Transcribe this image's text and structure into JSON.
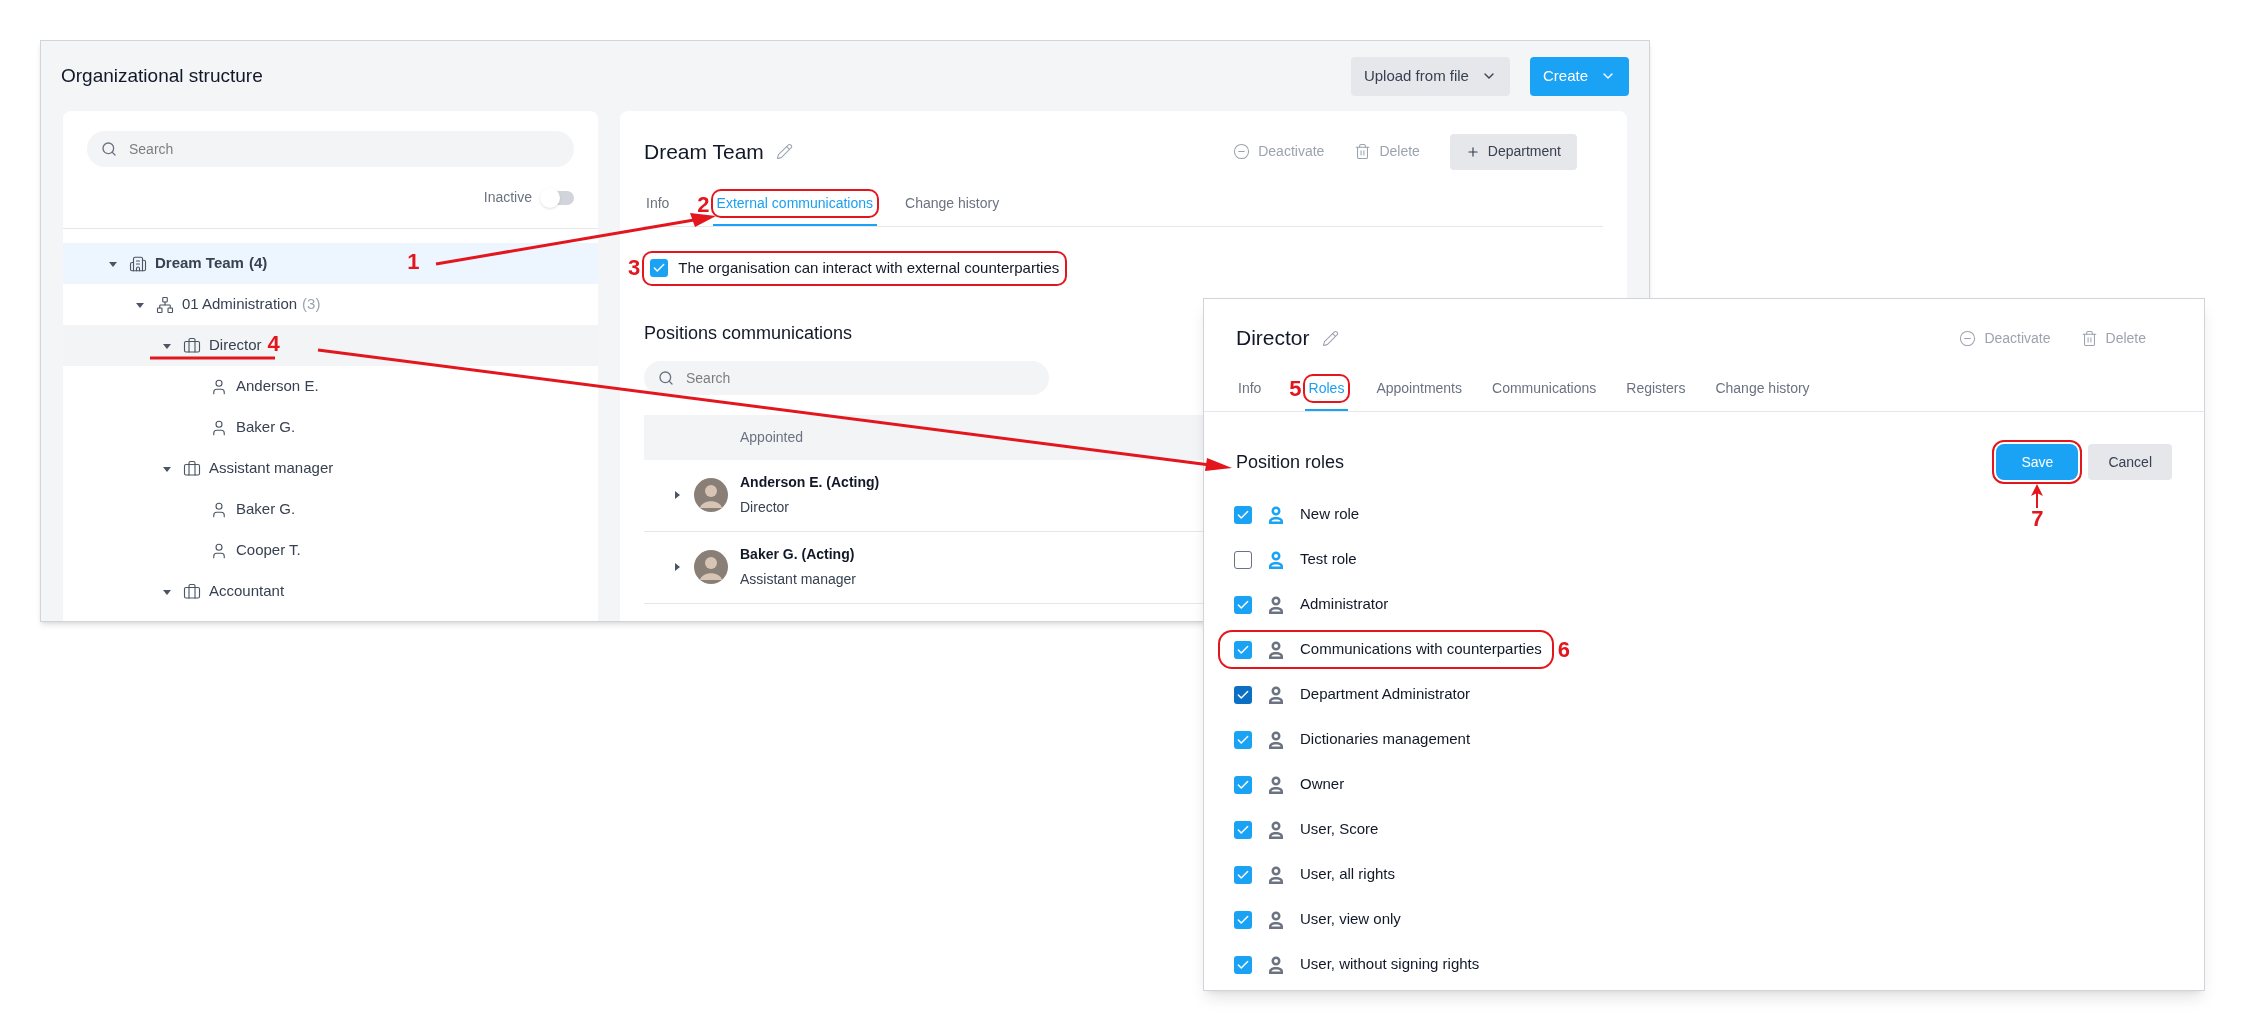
{
  "main_window": {
    "title": "Organizational structure",
    "buttons": [
      {
        "label": "Upload from file",
        "kind": "secondary"
      },
      {
        "label": "Create",
        "kind": "primary"
      }
    ],
    "sidebar": {
      "search": {
        "placeholder": "Search"
      },
      "inactive_toggle": {
        "label": "Inactive",
        "on": false
      },
      "tree": [
        {
          "label": "Dream Team",
          "count": "(4)",
          "kind": "organization",
          "expanded": true,
          "selected": true,
          "highlighted": false,
          "callout": "1",
          "children": [
            {
              "label": "01 Administration",
              "count": "(3)",
              "kind": "department",
              "expanded": true,
              "selected": false,
              "highlighted": false,
              "children": [
                {
                  "label": "Director",
                  "kind": "position",
                  "expanded": true,
                  "selected": false,
                  "highlighted": true,
                  "callout": "4",
                  "children": [
                    {
                      "label": "Anderson E.",
                      "kind": "person",
                      "selected": false,
                      "highlighted": false
                    },
                    {
                      "label": "Baker G.",
                      "kind": "person",
                      "selected": false,
                      "highlighted": false
                    }
                  ]
                },
                {
                  "label": "Assistant manager",
                  "kind": "position",
                  "expanded": true,
                  "selected": false,
                  "highlighted": false,
                  "children": [
                    {
                      "label": "Baker G.",
                      "kind": "person",
                      "selected": false,
                      "highlighted": false
                    },
                    {
                      "label": "Cooper T.",
                      "kind": "person",
                      "selected": false,
                      "highlighted": false
                    }
                  ]
                },
                {
                  "label": "Accountant",
                  "kind": "position",
                  "expanded": true,
                  "selected": false,
                  "highlighted": false
                }
              ]
            }
          ]
        }
      ]
    },
    "detail": {
      "title": "Dream Team",
      "actions": [
        {
          "label": "Deactivate",
          "kind": "deactivate"
        },
        {
          "label": "Delete",
          "kind": "delete"
        },
        {
          "label": "Department",
          "kind": "add"
        }
      ],
      "tabs": [
        {
          "label": "Info",
          "selected": false
        },
        {
          "label": "External communications",
          "selected": true,
          "callout": "2"
        },
        {
          "label": "Change history",
          "selected": false
        }
      ],
      "interaction_checkbox": {
        "label": "The organisation can interact with external counterparties",
        "checked": true,
        "callout": "3"
      },
      "section_title": "Positions communications",
      "search": {
        "placeholder": "Search"
      },
      "table": {
        "columns": [
          "Appointed"
        ],
        "rows": [
          {
            "name": "Anderson E. (Acting)",
            "position": "Director",
            "expanded": false
          },
          {
            "name": "Baker G. (Acting)",
            "position": "Assistant manager",
            "expanded": false
          }
        ]
      }
    }
  },
  "position_window": {
    "title": "Director",
    "actions": [
      {
        "label": "Deactivate",
        "kind": "deactivate"
      },
      {
        "label": "Delete",
        "kind": "delete"
      }
    ],
    "tabs": [
      {
        "label": "Info",
        "selected": false
      },
      {
        "label": "Roles",
        "selected": true,
        "callout": "5"
      },
      {
        "label": "Appointments",
        "selected": false
      },
      {
        "label": "Communications",
        "selected": false
      },
      {
        "label": "Registers",
        "selected": false
      },
      {
        "label": "Change history",
        "selected": false
      }
    ],
    "section_title": "Position roles",
    "buttons": [
      {
        "label": "Save",
        "kind": "primary",
        "callout": "7"
      },
      {
        "label": "Cancel",
        "kind": "secondary"
      }
    ],
    "roles": [
      {
        "label": "New role",
        "checked": true,
        "focused": false,
        "color": "#1aa3f5"
      },
      {
        "label": "Test role",
        "checked": false,
        "focused": false,
        "color": "#1aa3f5"
      },
      {
        "label": "Administrator",
        "checked": true,
        "focused": false,
        "color": "#6b7280"
      },
      {
        "label": "Communications with counterparties",
        "checked": true,
        "focused": false,
        "color": "#6b7280",
        "callout": "6"
      },
      {
        "label": "Department Administrator",
        "checked": true,
        "focused": true,
        "color": "#6b7280"
      },
      {
        "label": "Dictionaries management",
        "checked": true,
        "focused": false,
        "color": "#6b7280"
      },
      {
        "label": "Owner",
        "checked": true,
        "focused": false,
        "color": "#6b7280"
      },
      {
        "label": "User, Score",
        "checked": true,
        "focused": false,
        "color": "#6b7280"
      },
      {
        "label": "User, all rights",
        "checked": true,
        "focused": false,
        "color": "#6b7280"
      },
      {
        "label": "User, view only",
        "checked": true,
        "focused": false,
        "color": "#6b7280"
      },
      {
        "label": "User, without signing rights",
        "checked": true,
        "focused": false,
        "color": "#6b7280"
      }
    ]
  }
}
